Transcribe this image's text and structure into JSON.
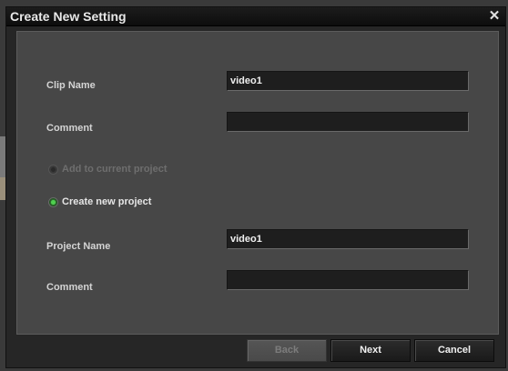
{
  "dialog": {
    "title": "Create New Setting",
    "close_label": "✕"
  },
  "form": {
    "clip_name_label": "Clip Name",
    "clip_name_value": "video1",
    "clip_comment_label": "Comment",
    "clip_comment_value": "",
    "add_to_current_label": "Add to current project",
    "add_to_current_enabled": false,
    "create_new_label": "Create new project",
    "create_new_selected": true,
    "project_name_label": "Project Name",
    "project_name_value": "video1",
    "project_comment_label": "Comment",
    "project_comment_value": ""
  },
  "buttons": {
    "back_label": "Back",
    "back_enabled": false,
    "next_label": "Next",
    "cancel_label": "Cancel"
  },
  "colors": {
    "radio_selected": "#4fd04f",
    "content_bg": "#474747",
    "titlebar_bg": "#111111"
  }
}
